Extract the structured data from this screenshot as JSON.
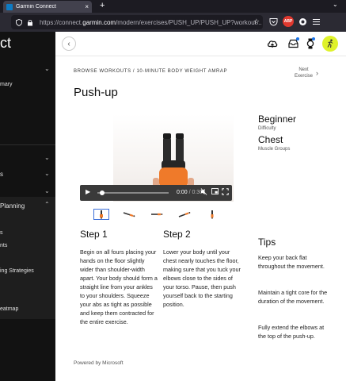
{
  "browser": {
    "tab_title": "Garmin Connect",
    "tab_close": "×",
    "new_tab": "+",
    "tab_list": "⌄",
    "url_prefix": "https://connect.",
    "url_domain": "garmin.com",
    "url_suffix": "/modern/exercises/PUSH_UP/PUSH_UP?workout...",
    "abp_label": "ABP"
  },
  "sidebar": {
    "logo_fragment": "ct",
    "summary_fragment": "mary",
    "planning_fragment": "Planning",
    "item_s": "s",
    "item_its": "nts",
    "strategies_fragment": "ing Strategies",
    "heatmap_fragment": "eatmap"
  },
  "header": {
    "back_label": "‹"
  },
  "breadcrumb": "BROWSE WORKOUTS / 10-MINUTE BODY WEIGHT AMRAP",
  "next_exercise": {
    "line1": "Next",
    "line2": "Exercise",
    "chevron": "›"
  },
  "page_title": "Push-up",
  "video": {
    "time_current": "0:00",
    "time_total": "/ 0:30"
  },
  "steps": [
    {
      "heading": "Step 1",
      "text": "Begin on all fours placing your hands on the floor slightly wider than shoulder-width apart. Your body should form a straight line from your ankles to your shoulders. Squeeze your abs as tight as possible and keep them contracted for the entire exercise."
    },
    {
      "heading": "Step 2",
      "text": "Lower your body until your chest nearly touches the floor, making sure that you tuck your elbows close to the sides of your torso. Pause, then push yourself back to the starting position."
    }
  ],
  "meta": {
    "difficulty_value": "Beginner",
    "difficulty_label": "Difficulty",
    "muscle_value": "Chest",
    "muscle_label": "Muscle Groups"
  },
  "tips": {
    "heading": "Tips",
    "items": [
      "Keep your back flat throughout the movement.",
      "Maintain a tight core for the duration of the movement.",
      "Fully extend the elbows at the top of the push-up."
    ]
  },
  "powered_by": "Powered by Microsoft",
  "colors": {
    "sidebar_bg": "#121212",
    "accent_avatar": "#dff22a",
    "shirt": "#ef7a2a",
    "notif_dot": "#1a73e8"
  }
}
